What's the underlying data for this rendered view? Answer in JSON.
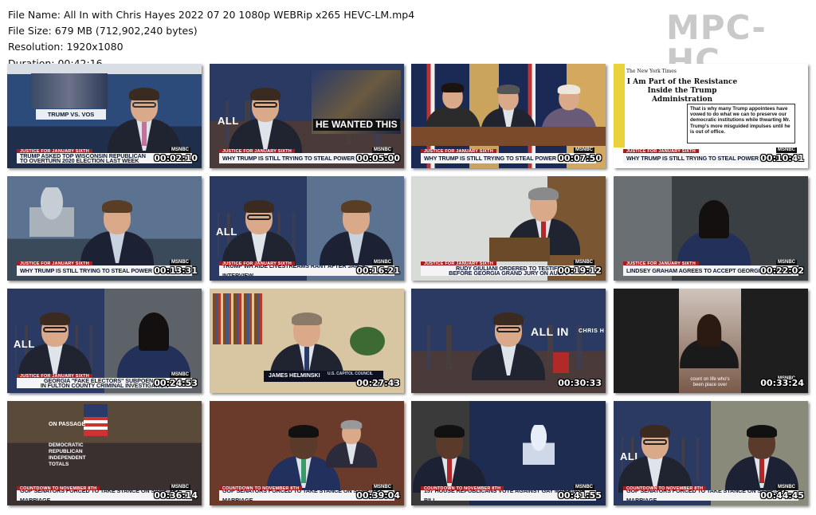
{
  "file_info": {
    "name_line": "File Name: All In with Chris Hayes 2022 07 20 1080p WEBRip x265 HEVC-LM.mp4",
    "size_line": "File Size: 679 MB (712,902,240 bytes)",
    "resolution_line": "Resolution: 1920x1080",
    "duration_line": "Duration: 00:42:16"
  },
  "brand": "MPC-HC",
  "colors": {
    "chyron_red": "#a51d22",
    "chyron_bg": "#f4f4f4",
    "brand_gray": "#c9c9c9"
  },
  "thumbnails": [
    {
      "timestamp": "00:02:10",
      "tag": "JUSTICE FOR JANUARY SIXTH",
      "caption": "TRUMP ASKED TOP WISCONSIN REPUBLICAN\nTO OVERTURN 2020 ELECTION LAST WEEK",
      "inset_label": "TRUMP VS. VOS"
    },
    {
      "timestamp": "00:05:00",
      "tag": "JUSTICE FOR JANUARY SIXTH",
      "caption": "WHY TRUMP IS STILL TRYING TO STEAL POWER TO THIS DAY",
      "overlay": "HE WANTED THIS",
      "show_logo": "ALL"
    },
    {
      "timestamp": "00:07:50",
      "tag": "JUSTICE FOR JANUARY SIXTH",
      "caption": "WHY TRUMP IS STILL TRYING TO STEAL POWER TO THIS DAY"
    },
    {
      "timestamp": "00:10:41",
      "tag": "JUSTICE FOR JANUARY SIXTH",
      "caption": "WHY TRUMP IS STILL TRYING TO STEAL POWER TO THIS DAY",
      "newspaper": "The New York Times",
      "headline": "I Am Part of the Resistance Inside the Trump Administration",
      "quote": "That is why many Trump appointees have vowed to do what we can to preserve our democratic institutions while thwarting Mr. Trump's more misguided impulses until he is out of office."
    },
    {
      "timestamp": "00:13:31",
      "tag": "JUSTICE FOR JANUARY SIXTH",
      "caption": "WHY TRUMP IS STILL TRYING TO STEAL POWER TO THIS DAY"
    },
    {
      "timestamp": "00:16:21",
      "tag": "JUSTICE FOR JANUARY SIXTH",
      "caption": "TRUMP WH AIDE LIVESTREAMS RANT AFTER JAN. 6 INTERVIEW",
      "show_logo": "ALL"
    },
    {
      "timestamp": "00:19:12",
      "tag": "JUSTICE FOR JANUARY SIXTH",
      "caption": "RUDY GIULIANI ORDERED TO TESTIFY\nBEFORE GEORGIA GRAND JURY ON AUG. 9"
    },
    {
      "timestamp": "00:22:02",
      "tag": "JUSTICE FOR JANUARY SIXTH",
      "caption": "LINDSEY GRAHAM AGREES TO ACCEPT GEORGIA SUBPOENA"
    },
    {
      "timestamp": "00:24:53",
      "tag": "JUSTICE FOR JANUARY SIXTH",
      "caption": "GEORGIA \"FAKE ELECTORS\" SUBPOENAED\nIN FULTON COUNTY CRIMINAL INVESTIGATION",
      "show_logo": "ALL"
    },
    {
      "timestamp": "00:27:43",
      "tag": "",
      "caption": "",
      "name_super": "JAMES HELMINSKI",
      "name_sub": "U.S. CAPITOL COUNCIL"
    },
    {
      "timestamp": "00:30:33",
      "tag": "",
      "caption": "",
      "show_logo": "ALL IN",
      "show_sub": "CHRIS H"
    },
    {
      "timestamp": "00:33:24",
      "tag": "",
      "caption": "",
      "subtitle": "count on life who's\nbeen place over"
    },
    {
      "timestamp": "00:36:14",
      "tag": "COUNTDOWN TO NOVEMBER 8TH",
      "caption": "GOP SENATORS FORCED TO TAKE STANCE ON SAME-SEX MARRIAGE",
      "vote_title": "ON PASSAGE",
      "vote_rows": [
        "DEMOCRATIC",
        "REPUBLICAN",
        "INDEPENDENT",
        "TOTALS"
      ]
    },
    {
      "timestamp": "00:39:04",
      "tag": "COUNTDOWN TO NOVEMBER 8TH",
      "caption": "GOP SENATORS FORCED TO TAKE STANCE ON SAME-SEX MARRIAGE"
    },
    {
      "timestamp": "00:41:55",
      "tag": "COUNTDOWN TO NOVEMBER 8TH",
      "caption": "157 HOUSE REPUBLICANS VOTE AGAINST GAY MARRIAGE BILL"
    },
    {
      "timestamp": "00:44:45",
      "tag": "COUNTDOWN TO NOVEMBER 8TH",
      "caption": "GOP SENATORS FORCED TO TAKE STANCE ON SAME-SEX MARRIAGE",
      "show_logo": "ALL"
    }
  ]
}
